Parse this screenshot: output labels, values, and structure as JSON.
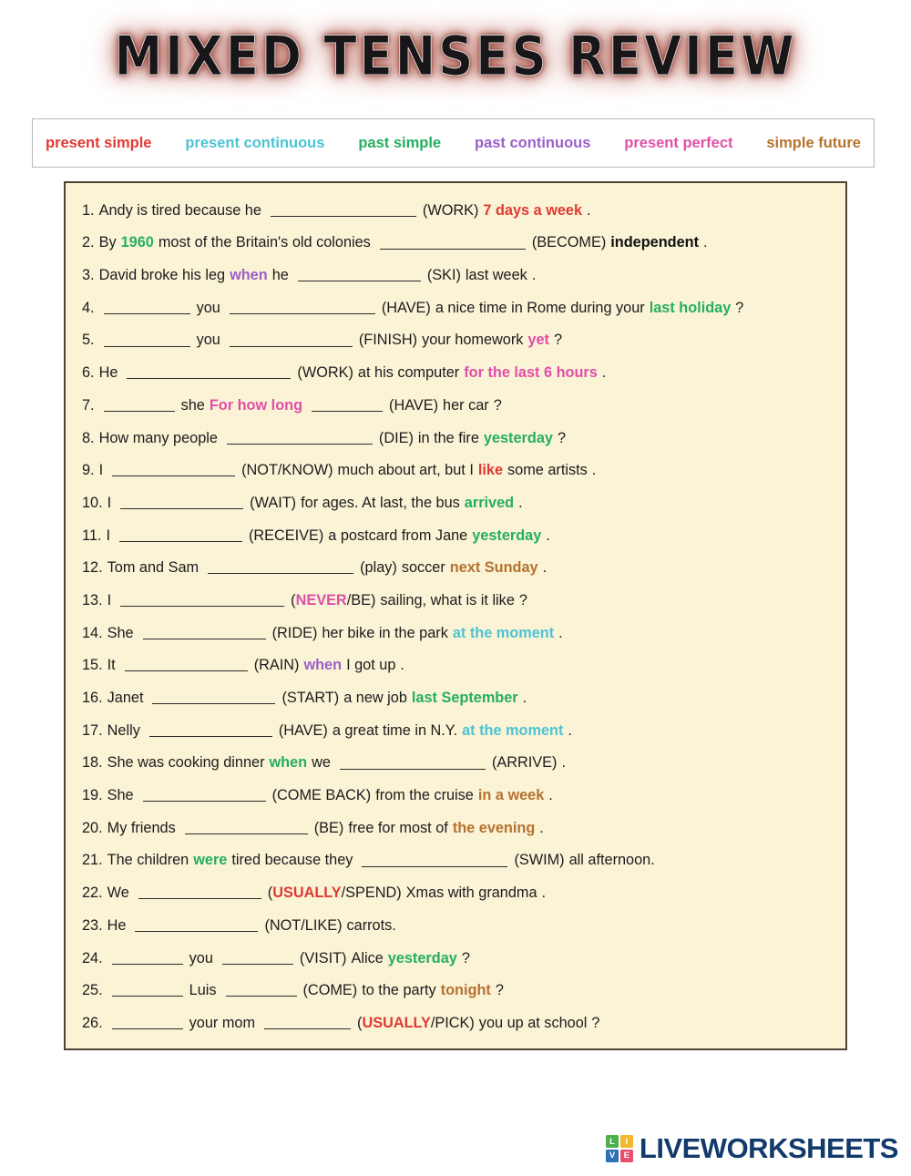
{
  "title": "MIXED TENSES REVIEW",
  "legend": {
    "items": [
      {
        "label": "present simple",
        "color": "#e03a32"
      },
      {
        "label": "present continuous",
        "color": "#4dc3d4"
      },
      {
        "label": "past simple",
        "color": "#27ae60"
      },
      {
        "label": "past continuous",
        "color": "#9b5fc9"
      },
      {
        "label": "present perfect",
        "color": "#e14fa8"
      },
      {
        "label": "simple future",
        "color": "#b5722f"
      }
    ]
  },
  "exercises": [
    {
      "num": "1.",
      "p1": "Andy is tired because he",
      "blank": "bl-lg",
      "verb": "(WORK)",
      "p2": "",
      "hl": "7 days a week",
      "hlc": "c-red",
      "p3": "."
    },
    {
      "num": "2.",
      "p1": "By",
      "hl0": "1960",
      "hl0c": "c-green",
      "p1b": "most of the Britain's old colonies",
      "blank": "bl-lg",
      "verb": "(BECOME)",
      "hl": "independent",
      "hlc": "c-black",
      "p3": "."
    },
    {
      "num": "3.",
      "p1": "David broke his leg",
      "hl0": "when",
      "hl0c": "c-purple",
      "p1b": "he",
      "blank": "bl-md",
      "verb": "(SKI)",
      "p2": "last week",
      "p3": "."
    },
    {
      "num": "4.",
      "blank0": "bl-sm",
      "p1": "you",
      "blank": "bl-lg",
      "verb": "(HAVE)",
      "p2": "a nice time in Rome during your",
      "hl": "last holiday",
      "hlc": "c-green",
      "p3": "?"
    },
    {
      "num": "5.",
      "blank0": "bl-sm",
      "p1": "you",
      "blank": "bl-md",
      "verb": "(FINISH)",
      "p2": "your homework",
      "hl": "yet",
      "hlc": "c-pink",
      "p3": "?"
    },
    {
      "num": "6.",
      "p1": "He",
      "blank": "bl-xl",
      "verb": "(WORK)",
      "p2": "at his computer",
      "hl": "for the last 6 hours",
      "hlc": "c-pink",
      "p3": "."
    },
    {
      "num": "7.",
      "hl0": "For how long",
      "hl0c": "c-pink",
      "blank0": "bl-xs",
      "p1": "she",
      "blank": "bl-xs",
      "verb": "(HAVE)",
      "p2": "her car",
      "p3": "?"
    },
    {
      "num": "8.",
      "p1": "How many people",
      "blank": "bl-lg",
      "verb": "(DIE)",
      "p2": "in the fire",
      "hl": "yesterday",
      "hlc": "c-green",
      "p3": "?"
    },
    {
      "num": "9.",
      "p1": "I",
      "blank": "bl-md",
      "verb": "(NOT/KNOW)",
      "p2": "much about art, but I",
      "hl": "like",
      "hlc": "c-red",
      "p2b": "some artists",
      "p3": "."
    },
    {
      "num": "10.",
      "p1": "I",
      "blank": "bl-md",
      "verb": "(WAIT)",
      "p2": "for ages. At last, the bus",
      "hl": "arrived",
      "hlc": "c-green",
      "p3": "."
    },
    {
      "num": "11.",
      "p1": "I",
      "blank": "bl-md",
      "verb": "(RECEIVE)",
      "p2": "a postcard from Jane",
      "hl": "yesterday",
      "hlc": "c-green",
      "p3": "."
    },
    {
      "num": "12.",
      "p1": "Tom and Sam",
      "blank": "bl-lg",
      "verb": "(play)",
      "p2": "soccer",
      "hl": "next Sunday",
      "hlc": "c-brown",
      "p3": "."
    },
    {
      "num": "13.",
      "p1": "I",
      "blank": "bl-xl",
      "verb_pre": "(",
      "verb_hl": "NEVER",
      "verb_hlc": "c-pink",
      "verb_post": "/BE)",
      "p2": "sailing, what is it like",
      "p3": "?"
    },
    {
      "num": "14.",
      "p1": "She",
      "blank": "bl-md",
      "verb": "(RIDE)",
      "p2": "her bike in the park",
      "hl": "at the moment",
      "hlc": "c-cyan",
      "p3": "."
    },
    {
      "num": "15.",
      "p1": "It",
      "blank": "bl-md",
      "verb": "(RAIN)",
      "hl": "when",
      "hlc": "c-purple",
      "p2b": "I got up",
      "p3": "."
    },
    {
      "num": "16.",
      "p1": "Janet",
      "blank": "bl-md",
      "verb": "(START)",
      "p2": "a new job",
      "hl": "last September",
      "hlc": "c-green",
      "p3": "."
    },
    {
      "num": "17.",
      "p1": "Nelly",
      "blank": "bl-md",
      "verb": "(HAVE)",
      "p2": "a great time in N.Y.",
      "hl": "at the moment",
      "hlc": "c-cyan",
      "p3": "."
    },
    {
      "num": "18.",
      "p1": "She was cooking dinner",
      "hl0": "when",
      "hl0c": "c-green",
      "p1b": "we",
      "blank": "bl-lg",
      "verb": "(ARRIVE)",
      "p3": "."
    },
    {
      "num": "19.",
      "p1": "She",
      "blank": "bl-md",
      "verb": "(COME BACK)",
      "p2": "from the cruise",
      "hl": "in a week",
      "hlc": "c-brown",
      "p3": "."
    },
    {
      "num": "20.",
      "p1": "My friends",
      "blank": "bl-md",
      "verb": "(BE)",
      "p2": "free for most of",
      "hl": "the evening",
      "hlc": "c-brown",
      "p3": "."
    },
    {
      "num": "21.",
      "p1": "The children",
      "hl0": "were",
      "hl0c": "c-green",
      "p1b": "tired because they",
      "blank": "bl-lg",
      "verb": "(SWIM)",
      "p2": "all afternoon.",
      "p3": ""
    },
    {
      "num": "22.",
      "p1": "We",
      "blank": "bl-md",
      "verb_pre": "(",
      "verb_hl": "USUALLY",
      "verb_hlc": "c-red",
      "verb_post": "/SPEND)",
      "p2": "Xmas with grandma",
      "p3": "."
    },
    {
      "num": "23.",
      "p1": "He",
      "blank": "bl-md",
      "verb": "(NOT/LIKE)",
      "p2": "carrots.",
      "p3": ""
    },
    {
      "num": "24.",
      "blank0": "bl-xs",
      "p1": "you",
      "blank": "bl-xs",
      "verb": "(VISIT)",
      "p2": "Alice",
      "hl": "yesterday",
      "hlc": "c-green",
      "p3": "?"
    },
    {
      "num": "25.",
      "blank0": "bl-xs",
      "p1": "Luis",
      "blank": "bl-xs",
      "verb": "(COME)",
      "p2": "to the party",
      "hl": "tonight",
      "hlc": "c-brown",
      "p3": "?"
    },
    {
      "num": "26.",
      "blank0": "bl-xs",
      "p1": "your mom",
      "blank": "bl-sm",
      "verb_pre": "(",
      "verb_hl": "USUALLY",
      "verb_hlc": "c-red",
      "verb_post": "/PICK)",
      "p2": "you up at school",
      "p3": "?"
    }
  ],
  "footer": {
    "logo_letters": [
      "L",
      "I",
      "V",
      "E"
    ],
    "brand": "LIVEWORKSHEETS"
  }
}
